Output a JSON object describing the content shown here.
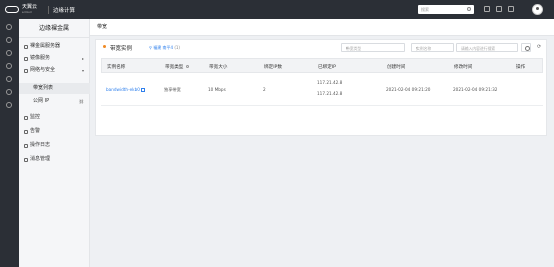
{
  "topbar": {
    "logo_text": "天翼云",
    "logo_sub": "e.Cloud",
    "product": "边缘计算",
    "search_placeholder": "搜索"
  },
  "sidebar": {
    "title": "边缘裸金属",
    "items": [
      {
        "label": "裸金属服务器",
        "icon": "server-icon"
      },
      {
        "label": "镜像服务",
        "icon": "image-icon",
        "chevron": "▸"
      },
      {
        "label": "网络与安全",
        "icon": "network-icon",
        "chevron": "▾"
      },
      {
        "label": "带宽列表",
        "sub": true,
        "active": true
      },
      {
        "label": "公网 IP",
        "sub": true,
        "extra": "link-icon"
      },
      {
        "label": "监控",
        "icon": "monitor-icon"
      },
      {
        "label": "告警",
        "icon": "alarm-icon"
      },
      {
        "label": "操作日志",
        "icon": "log-icon"
      },
      {
        "label": "消息管理",
        "icon": "message-icon"
      }
    ]
  },
  "breadcrumb": "带宽",
  "panel": {
    "title": "带宽实例",
    "region_label": "福建",
    "region_sub": "南平4",
    "region_count": "(1)",
    "filters": [
      {
        "placeholder": "带宽类型"
      },
      {
        "placeholder": "实例名称"
      },
      {
        "placeholder": "请输入内容进行搜索"
      }
    ],
    "refresh_symbol": "⟳"
  },
  "table": {
    "columns": [
      "实例名称",
      "带宽类型",
      "带宽大小",
      "绑定IP数",
      "已绑定IP",
      "创建时间",
      "修改时间",
      "操作"
    ],
    "rows": [
      {
        "name": "bandwidth-ekb0",
        "type": "独享带宽",
        "size": "10 Mbps",
        "ip_count": "2",
        "ips": [
          "117.21.42.8",
          "117.21.42.8"
        ],
        "created": "2021-02-04 09:21:20",
        "modified": "2021-02-04 09:21:32",
        "action": ""
      }
    ]
  },
  "colors": {
    "topbar": "#2b2f36",
    "accent": "#2f80ed",
    "status_dot": "#f08a24"
  }
}
